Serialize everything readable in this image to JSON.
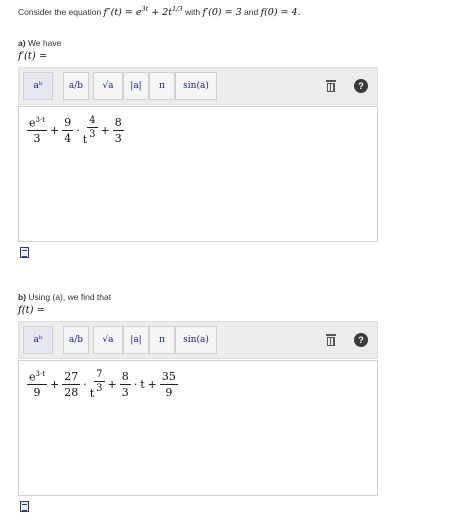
{
  "intro": {
    "prefix": "Consider the equation",
    "equation": "f″(t) = e",
    "exp1": "3t",
    "plus": "+ 2t",
    "exp2": "1/3",
    "with": "with",
    "cond1": "f′(0) = 3",
    "and": "and",
    "cond2": "f(0) = 4."
  },
  "toolbar": {
    "buttons": [
      "aᵇ",
      "a/b",
      "√a",
      "|a|",
      "π",
      "sin(a)"
    ]
  },
  "part_a": {
    "letter": "a)",
    "text": "We have",
    "lhs": "f′(t) =",
    "term1": {
      "num_base": "e",
      "num_exp": "3·t",
      "den": "3"
    },
    "op1": "+",
    "term2": {
      "num": "9",
      "den": "4"
    },
    "dot": "·",
    "t_pow": {
      "base": "t",
      "exp_num": "4",
      "exp_den": "3"
    },
    "op2": "+",
    "term3": {
      "num": "8",
      "den": "3"
    }
  },
  "part_b": {
    "letter": "b)",
    "text": "Using (a), we find that",
    "lhs": "f(t) =",
    "term1": {
      "num_base": "e",
      "num_exp": "3·t",
      "den": "9"
    },
    "op1": "+",
    "term2": {
      "num": "27",
      "den": "28"
    },
    "dot": "·",
    "t_pow": {
      "base": "t",
      "exp_num": "7",
      "exp_den": "3"
    },
    "op2": "+",
    "term3": {
      "num": "8",
      "den": "3"
    },
    "dot2": "·",
    "t": "t",
    "op3": "+",
    "term4": {
      "num": "35",
      "den": "9"
    }
  }
}
